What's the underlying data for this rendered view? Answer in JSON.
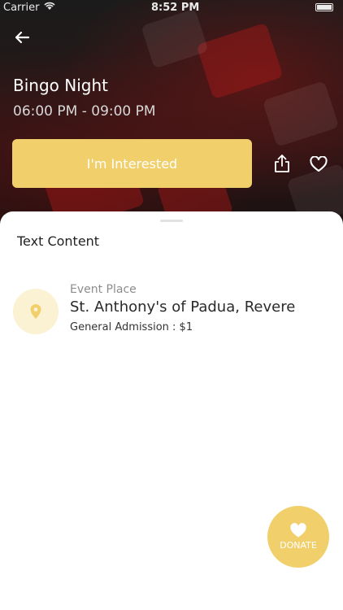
{
  "status_bar": {
    "carrier": "Carrier",
    "time": "8:52 PM"
  },
  "event": {
    "title": "Bingo Night",
    "time_range": "06:00 PM - 09:00 PM",
    "interested_label": "I'm Interested"
  },
  "icons": {
    "back": "arrow-left-icon",
    "share": "share-icon",
    "favorite": "heart-outline-icon",
    "location": "location-pin-icon",
    "donate": "heart-filled-icon"
  },
  "sheet": {
    "section_title": "Text Content",
    "place": {
      "label": "Event Place",
      "name": "St. Anthony's of Padua, Revere",
      "admission": "General Admission : $1"
    }
  },
  "donate": {
    "label": "DONATE"
  },
  "colors": {
    "accent": "#f1cf6b",
    "accent_light": "#fbf1d3",
    "hero_dark": "#1b1b1b"
  }
}
